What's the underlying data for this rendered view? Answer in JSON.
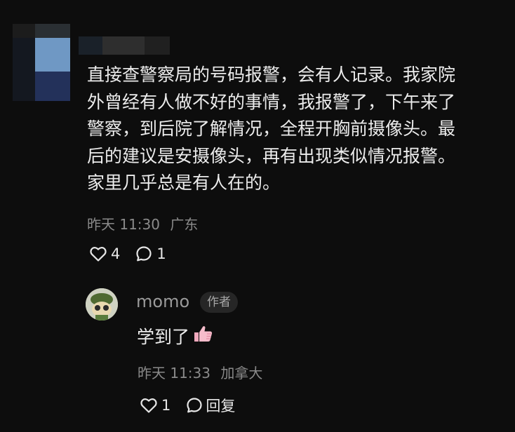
{
  "comment": {
    "lines": [
      "直接查警察局的号码报警，会有人记录。我家院",
      "外曾经有人做不好的事情，我报警了，下午来了",
      "警察，到后院了解情况，全程开胸前摄像头。最",
      "后的建议是安摄像头，再有出现类似情况报警。",
      "家里几乎总是有人在的。"
    ],
    "time": "昨天 11:30",
    "location": "广东",
    "likes": "4",
    "comments": "1"
  },
  "reply": {
    "author": "momo",
    "badge": "作者",
    "text": "学到了",
    "emoji": "thumbs-up-pink",
    "time": "昨天 11:33",
    "location": "加拿大",
    "likes": "1",
    "reply_label": "回复"
  }
}
